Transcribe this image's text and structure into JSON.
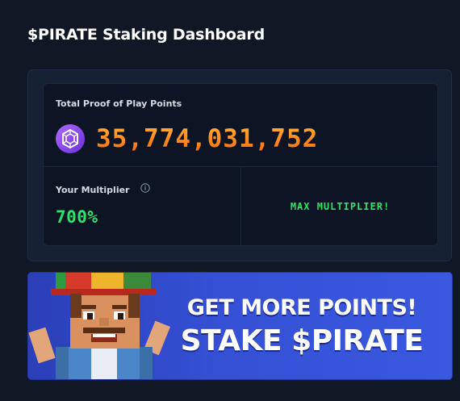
{
  "page": {
    "title": "$PIRATE Staking Dashboard"
  },
  "points": {
    "label": "Total Proof of Play Points",
    "value": "35,774,031,752",
    "icon": "points-gem-icon"
  },
  "multiplier": {
    "label": "Your Multiplier",
    "value": "700%",
    "info_icon": "info-icon",
    "status": "MAX MULTIPLIER!"
  },
  "banner": {
    "line1": "GET MORE POINTS!",
    "line2": "STAKE $PIRATE"
  },
  "colors": {
    "background": "#101826",
    "card": "#142133",
    "inner_card": "#0d1524",
    "points_orange": "#ff8a1c",
    "multiplier_green": "#2be36b",
    "banner_blue": "#3550d4"
  }
}
